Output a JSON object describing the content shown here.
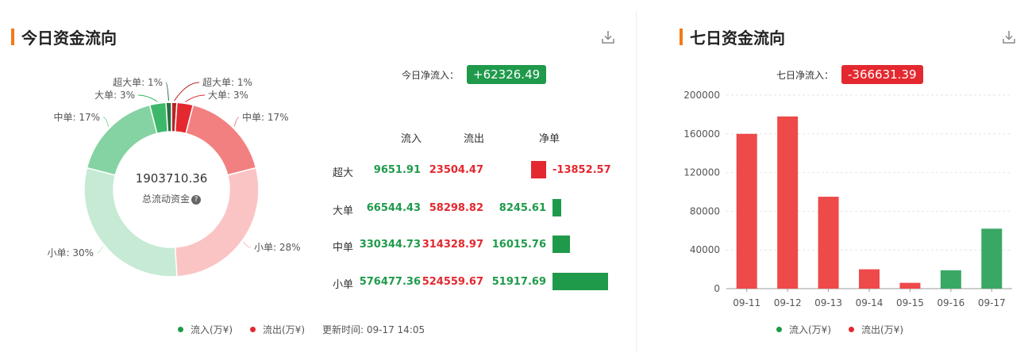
{
  "today": {
    "title": "今日资金流向",
    "net_label": "今日净流入：",
    "net_value": "+62326.49",
    "net_color": "#1f9a4b",
    "total_value": "1903710.36",
    "total_label": "总流动资金",
    "help_icon": "question-circle-icon",
    "download_icon": "download-icon",
    "headers": {
      "in": "流入",
      "out": "流出",
      "net": "净单"
    },
    "rows": [
      {
        "label": "超大",
        "in": "9651.91",
        "out": "23504.47",
        "net": "-13852.57",
        "net_value": -13852.57
      },
      {
        "label": "大单",
        "in": "66544.43",
        "out": "58298.82",
        "net": "8245.61",
        "net_value": 8245.61
      },
      {
        "label": "中单",
        "in": "330344.73",
        "out": "314328.97",
        "net": "16015.76",
        "net_value": 16015.76
      },
      {
        "label": "小单",
        "in": "576477.36",
        "out": "524559.67",
        "net": "51917.69",
        "net_value": 51917.69
      }
    ],
    "legend": {
      "in": "流入(万¥)",
      "out": "流出(万¥)",
      "updated": "更新时间: 09-17 14:05"
    }
  },
  "week": {
    "title": "七日资金流向",
    "net_label": "七日净流入：",
    "net_value": "-366631.39",
    "net_color": "#e4282f",
    "download_icon": "download-icon",
    "legend": {
      "in": "流入(万¥)",
      "out": "流出(万¥)"
    }
  },
  "colors": {
    "in": "#1f9a4b",
    "out": "#e4282f",
    "bar_red": "#ee4a4a",
    "bar_green": "#3aa865",
    "accent": "#f07a18"
  },
  "chart_data": [
    {
      "type": "pie",
      "donut": true,
      "center_value": "1903710.36",
      "center_label": "总流动资金",
      "slices": [
        {
          "label": "超大单: 1%",
          "side": "out",
          "percent": 1,
          "color": "#b52626"
        },
        {
          "label": "大单: 3%",
          "side": "out",
          "percent": 3,
          "color": "#e4282f"
        },
        {
          "label": "中单: 17%",
          "side": "out",
          "percent": 17,
          "color": "#f28080"
        },
        {
          "label": "小单: 28%",
          "side": "out",
          "percent": 28,
          "color": "#fbc4c4"
        },
        {
          "label": "小单: 30%",
          "side": "in",
          "percent": 30,
          "color": "#c6ead4"
        },
        {
          "label": "中单: 17%",
          "side": "in",
          "percent": 17,
          "color": "#85d3a2"
        },
        {
          "label": "大单: 3%",
          "side": "in",
          "percent": 3,
          "color": "#3db86a"
        },
        {
          "label": "超大单: 1%",
          "side": "in",
          "percent": 1,
          "color": "#2d6b45"
        }
      ]
    },
    {
      "type": "bar",
      "categories": [
        "09-11",
        "09-12",
        "09-13",
        "09-14",
        "09-15",
        "09-16",
        "09-17"
      ],
      "values": [
        160000,
        178000,
        95000,
        20000,
        6000,
        19000,
        62000
      ],
      "directions": [
        "out",
        "out",
        "out",
        "out",
        "out",
        "in",
        "in"
      ],
      "ylim": [
        0,
        200000
      ],
      "yticks": [
        0,
        40000,
        80000,
        120000,
        160000,
        200000
      ],
      "grid": true
    }
  ]
}
